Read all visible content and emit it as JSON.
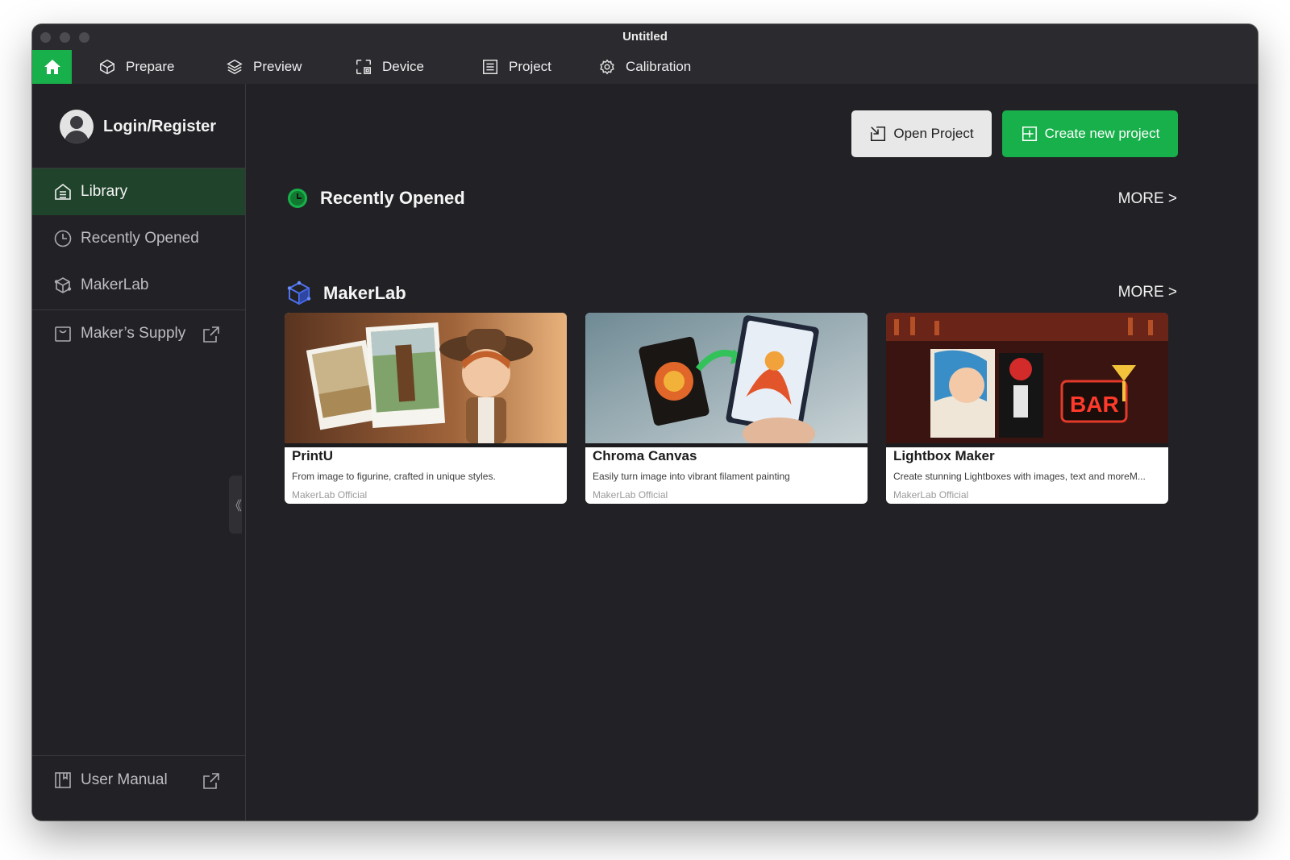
{
  "window": {
    "title": "Untitled"
  },
  "menu": {
    "items": [
      {
        "label": "Prepare",
        "icon": "cube-icon"
      },
      {
        "label": "Preview",
        "icon": "layers-icon"
      },
      {
        "label": "Device",
        "icon": "device-icon"
      },
      {
        "label": "Project",
        "icon": "project-list-icon"
      },
      {
        "label": "Calibration",
        "icon": "gear-icon"
      }
    ],
    "home_icon": "home-icon"
  },
  "sidebar": {
    "profile_label": "Login/Register",
    "items": [
      {
        "label": "Library",
        "icon": "library-icon",
        "active": true
      },
      {
        "label": "Recently Opened",
        "icon": "clock-icon"
      },
      {
        "label": "MakerLab",
        "icon": "makerlab-cube-icon"
      },
      {
        "label": "Maker’s Supply",
        "icon": "bag-icon",
        "external": true
      }
    ],
    "footer": {
      "label": "User Manual",
      "icon": "book-icon",
      "external": true
    },
    "collapse_glyph": "《"
  },
  "actions": {
    "open_project": "Open Project",
    "create_project": "Create new project"
  },
  "sections": {
    "recent": {
      "title": "Recently Opened",
      "more": "MORE >"
    },
    "makerlab": {
      "title": "MakerLab",
      "more": "MORE >"
    }
  },
  "cards": [
    {
      "title": "PrintU",
      "description": "From image to figurine, crafted in unique styles.",
      "author": "MakerLab Official"
    },
    {
      "title": "Chroma Canvas",
      "description": "Easily turn image into vibrant filament painting",
      "author": "MakerLab Official"
    },
    {
      "title": "Lightbox Maker",
      "description": "Create stunning Lightboxes with images, text and moreM...",
      "author": "MakerLab Official"
    }
  ],
  "colors": {
    "accent": "#18b04a",
    "background": "#222226",
    "sidebar_active": "#20442b"
  }
}
